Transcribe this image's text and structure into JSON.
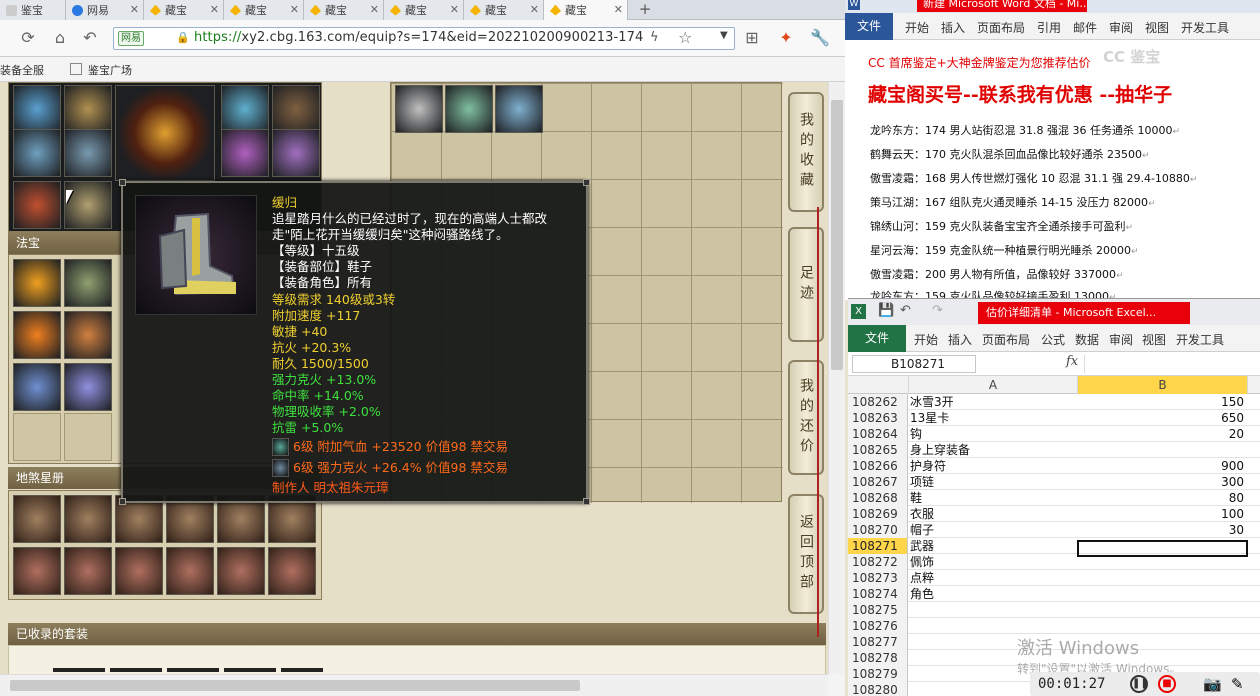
{
  "browser": {
    "tabs": [
      {
        "label": "鉴宝"
      },
      {
        "label": "网易"
      },
      {
        "label": "藏宝"
      },
      {
        "label": "藏宝"
      },
      {
        "label": "藏宝"
      },
      {
        "label": "藏宝"
      },
      {
        "label": "藏宝"
      },
      {
        "label": "藏宝"
      }
    ],
    "new_tab": "+",
    "url_badge": "网易",
    "url_https": "https://",
    "url_domain": "xy2.cbg.163.com",
    "url_path": "/equip?s=174&eid=202210200900213-174",
    "bookmarks": [
      "装备全服",
      "鉴宝广场"
    ]
  },
  "page": {
    "sections": {
      "fabao": "法宝",
      "disha": "地煞星册",
      "collected": "已收录的套装"
    },
    "side_buttons": [
      "我的收藏",
      "足迹",
      "我的还价",
      "返回顶部"
    ]
  },
  "tooltip": {
    "lines": [
      {
        "text": "缓归",
        "color": "#f0d030"
      },
      {
        "text": "追星踏月什么的已经过时了，现在的高端人士都改",
        "color": "#ffffff"
      },
      {
        "text": "走\"陌上花开当缓缓归矣\"这种闷骚路线了。",
        "color": "#ffffff"
      },
      {
        "text": "【等级】十五级",
        "color": "#ffffff"
      },
      {
        "text": "【装备部位】鞋子",
        "color": "#ffffff"
      },
      {
        "text": "【装备角色】所有",
        "color": "#ffffff"
      },
      {
        "text": "等级需求 140级或3转",
        "color": "#f0d030"
      },
      {
        "text": "附加速度 +117",
        "color": "#f0d030"
      },
      {
        "text": "敏捷 +40",
        "color": "#f0d030"
      },
      {
        "text": "抗火 +20.3%",
        "color": "#f0d030"
      },
      {
        "text": "耐久 1500/1500",
        "color": "#f0d030"
      },
      {
        "text": "强力克火 +13.0%",
        "color": "#3ee03e"
      },
      {
        "text": "命中率 +14.0%",
        "color": "#3ee03e"
      },
      {
        "text": "物理吸收率 +2.0%",
        "color": "#3ee03e"
      },
      {
        "text": "抗雷 +5.0%",
        "color": "#3ee03e"
      }
    ],
    "gems": [
      {
        "text": "6级 附加气血 +23520 价值98 禁交易",
        "color": "#ff6a1a",
        "gem_color": "#5aa898"
      },
      {
        "text": "6级 强力克火 +26.4% 价值98 禁交易",
        "color": "#ff6a1a",
        "gem_color": "#7088a0"
      }
    ],
    "maker": {
      "text": "制作人 明太祖朱元璋",
      "color": "#ff5a1a"
    }
  },
  "word": {
    "title": "新建 Microsoft Word 文档 - Mi...",
    "tabs": [
      "文件",
      "开始",
      "插入",
      "页面布局",
      "引用",
      "邮件",
      "审阅",
      "视图",
      "开发工具"
    ],
    "line1": "CC 首席鉴定+大神金牌鉴定为您推荐估价",
    "line2": "藏宝阁买号--联系我有优惠 --抽华子",
    "watermark": "CC 鉴宝",
    "lines": [
      "龙吟东方：174 男人站街忍混 31.8 强混 36 任务通杀 10000",
      "鹤舞云天：170 克火队混杀回血品像比较好通杀 23500",
      "傲雪凌霜：168 男人传世燃灯强化 10 忍混 31.1 强 29.4-10880",
      "策马江湖：167 组队克火通灵睡杀 14-15 没压力 82000",
      "锦绣山河：159 克火队装备宝宝齐全通杀接手可盈利",
      "星河云海：159 克金队统一种植景行明光睡杀 20000",
      "傲雪凌霜：200 男人物有所值，品像较好 337000",
      "龙吟东方：159 克火队品像较好接手盈利 13000"
    ]
  },
  "excel": {
    "title": "估价详细清单 - Microsoft Excel...",
    "tabs": [
      "文件",
      "开始",
      "插入",
      "页面布局",
      "公式",
      "数据",
      "审阅",
      "视图",
      "开发工具"
    ],
    "namebox": "B108271",
    "fx": "fx",
    "col_a": "A",
    "col_b": "B",
    "rows": [
      {
        "n": "108262",
        "a": "冰雪3开",
        "b": "150"
      },
      {
        "n": "108263",
        "a": "13星卡",
        "b": "650"
      },
      {
        "n": "108264",
        "a": "钩",
        "b": "20"
      },
      {
        "n": "108265",
        "a": "身上穿装备",
        "b": ""
      },
      {
        "n": "108266",
        "a": "护身符",
        "b": "900"
      },
      {
        "n": "108267",
        "a": "项链",
        "b": "300"
      },
      {
        "n": "108268",
        "a": "鞋",
        "b": "80"
      },
      {
        "n": "108269",
        "a": "衣服",
        "b": "100"
      },
      {
        "n": "108270",
        "a": "帽子",
        "b": "30"
      },
      {
        "n": "108271",
        "a": "武器",
        "b": ""
      },
      {
        "n": "108272",
        "a": "佩饰",
        "b": ""
      },
      {
        "n": "108273",
        "a": "点粹",
        "b": ""
      },
      {
        "n": "108274",
        "a": "角色",
        "b": ""
      },
      {
        "n": "108275",
        "a": "",
        "b": ""
      },
      {
        "n": "108276",
        "a": "",
        "b": ""
      },
      {
        "n": "108277",
        "a": "",
        "b": ""
      },
      {
        "n": "108278",
        "a": "",
        "b": ""
      },
      {
        "n": "108279",
        "a": "",
        "b": ""
      },
      {
        "n": "108280",
        "a": "",
        "b": ""
      }
    ]
  },
  "overlay": {
    "activate_title": "激活 Windows",
    "activate_sub": "转到\"设置\"以激活 Windows。",
    "recording_time": "00:01:27"
  },
  "colors": {
    "excel_green": "#217346",
    "word_blue": "#2b579a",
    "highlight_red": "#e00000"
  }
}
